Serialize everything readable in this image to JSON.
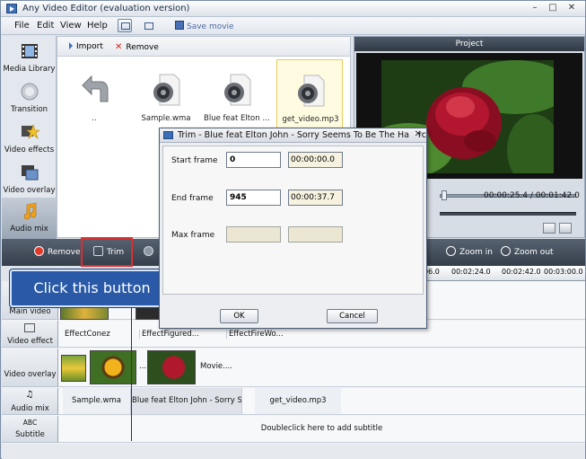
{
  "window": {
    "title": "Any Video Editor (evaluation version)",
    "minimize": "–",
    "maximize": "□",
    "close": "✕"
  },
  "menu": {
    "items": [
      "File",
      "Edit",
      "View",
      "Help"
    ],
    "save_movie": "Save movie"
  },
  "sidebar": {
    "items": [
      {
        "label": "Media Library",
        "icon": "film-icon"
      },
      {
        "label": "Transition",
        "icon": "transition-icon"
      },
      {
        "label": "Video effects",
        "icon": "effects-star-icon"
      },
      {
        "label": "Video overlay",
        "icon": "overlay-icon"
      },
      {
        "label": "Audio mix",
        "icon": "music-note-icon"
      }
    ]
  },
  "library": {
    "import_label": "Import",
    "remove_label": "Remove",
    "files": [
      "..",
      "Sample.wma",
      "Blue feat Elton John...",
      "get_video.mp3"
    ]
  },
  "project": {
    "title": "Project",
    "time_current": "00:00:25.4",
    "time_total": "00:01:42.0",
    "time_separator": "/"
  },
  "timeline": {
    "remove_label": "Remove",
    "trim_label": "Trim",
    "zoom_in_label": "Zoom in",
    "zoom_out_label": "Zoom out",
    "ruler": [
      "06.0",
      "00:02:24.0",
      "00:02:42.0",
      "00:03:00.0"
    ],
    "tracks": {
      "main_video": "Main video",
      "video_effect": "Video effect",
      "video_overlay": "Video overlay",
      "audio_mix": "Audio mix",
      "subtitle_tag": "ABC",
      "subtitle": "Subtitle"
    },
    "effects": [
      "EffectConez",
      "EffectFigured...",
      "EffectFireWo..."
    ],
    "overlay_clip": "Movie....",
    "overlay_dots": "...",
    "audio_clips": [
      "Sample.wma",
      "Blue feat Elton John - Sorry S...",
      "get_video.mp3"
    ],
    "subtitle_hint": "Doubleclick here to add subtitle"
  },
  "callout": {
    "text": "Click this button"
  },
  "trim_dialog": {
    "title": "Trim - Blue feat Elton John - Sorry Seems To Be The Ha",
    "behind_text": "rc",
    "close": "✕",
    "start_label": "Start frame",
    "start_value": "0",
    "start_time": "00:00:00.0",
    "end_label": "End frame",
    "end_value": "945",
    "end_time": "00:00:37.7",
    "max_label": "Max frame",
    "ok_label": "OK",
    "cancel_label": "Cancel"
  }
}
